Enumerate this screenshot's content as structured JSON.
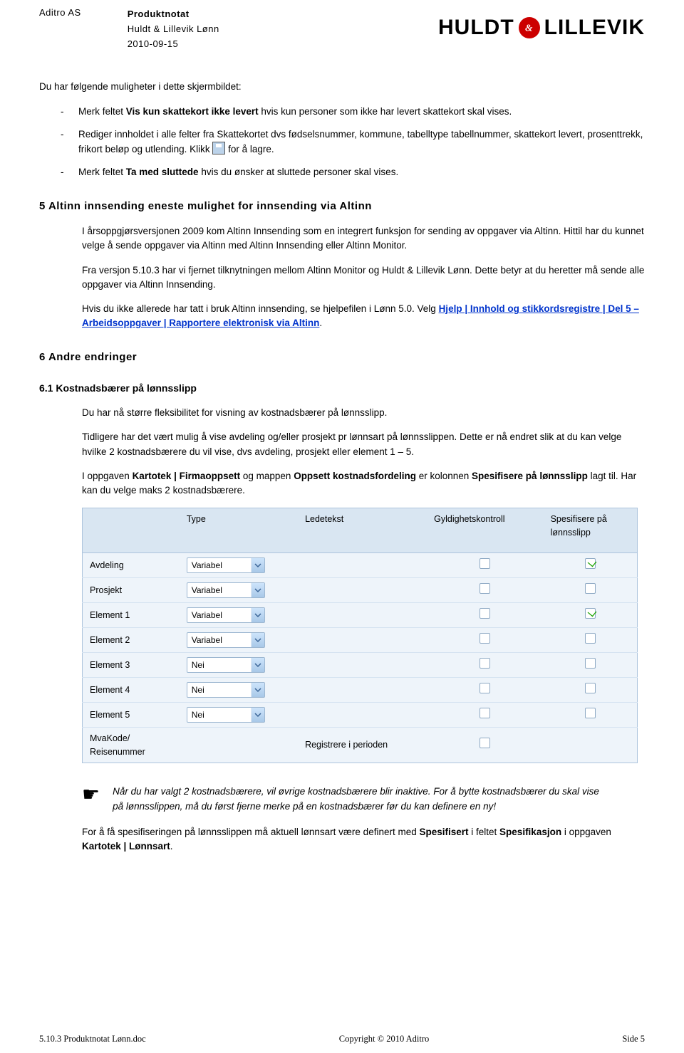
{
  "header": {
    "company": "Aditro AS",
    "title": "Produktnotat",
    "product": "Huldt & Lillevik Lønn",
    "date": "2010-09-15",
    "logo_text1": "HULDT",
    "logo_text2": "LILLEVIK"
  },
  "intro": "Du har følgende muligheter i dette skjermbildet:",
  "bullets": {
    "b1_a": "Merk feltet ",
    "b1_bold": "Vis kun skattekort ikke levert",
    "b1_b": " hvis kun personer som ikke har levert skattekort skal vises.",
    "b2_a": "Rediger innholdet i alle felter fra Skattekortet dvs fødselsnummer, kommune, tabelltype tabellnummer, skattekort levert, prosenttrekk, frikort beløp og utlending. Klikk ",
    "b2_b": " for å lagre.",
    "b3_a": "Merk feltet ",
    "b3_bold": "Ta med sluttede",
    "b3_b": " hvis du ønsker at sluttede personer skal vises."
  },
  "sec5_title": "5 Altinn innsending eneste mulighet for innsending via Altinn",
  "sec5": {
    "p1": "I årsoppgjørsversjonen 2009 kom Altinn Innsending som en integrert funksjon for sending av oppgaver via Altinn. Hittil har du kunnet velge å sende oppgaver via Altinn med Altinn Innsending eller Altinn Monitor.",
    "p2": "Fra versjon 5.10.3 har vi fjernet tilknytningen mellom Altinn Monitor og Huldt & Lillevik Lønn. Dette betyr at du heretter må sende alle oppgaver via Altinn Innsending.",
    "p3a": "Hvis du ikke allerede har tatt i bruk Altinn innsending, se hjelpefilen i Lønn 5.0.  Velg ",
    "p3link": "Hjelp | Innhold og stikkordsregistre | Del 5 – Arbeidsoppgaver | Rapportere elektronisk via Altinn",
    "p3b": "."
  },
  "sec6_title": "6 Andre endringer",
  "sec61_title": "6.1 Kostnadsbærer på lønnsslipp",
  "sec61": {
    "p1": "Du har nå større fleksibilitet for visning av kostnadsbærer på lønnsslipp.",
    "p2": "Tidligere har det vært mulig å vise avdeling og/eller prosjekt pr lønnsart på lønnsslippen. Dette er nå endret slik at du kan velge hvilke 2 kostnadsbærere du vil vise, dvs avdeling, prosjekt eller element 1 – 5.",
    "p3a": "I oppgaven ",
    "p3bold1": "Kartotek | Firmaoppsett",
    "p3mid": " og mappen ",
    "p3bold2": "Oppsett kostnadsfordeling",
    "p3b": " er kolonnen ",
    "p3bold3": "Spesifisere på lønnsslipp",
    "p3c": " lagt til. Har kan du velge maks 2 kostnadsbærere."
  },
  "table": {
    "headers": [
      "",
      "Type",
      "Ledetekst",
      "Gyldighetskontroll",
      "Spesifisere på lønnsslipp"
    ],
    "rows": [
      {
        "label": "Avdeling",
        "type": "Variabel",
        "ledetekst": "",
        "gk": false,
        "sp": true
      },
      {
        "label": "Prosjekt",
        "type": "Variabel",
        "ledetekst": "",
        "gk": false,
        "sp": false
      },
      {
        "label": "Element 1",
        "type": "Variabel",
        "ledetekst": "",
        "gk": false,
        "sp": true
      },
      {
        "label": "Element 2",
        "type": "Variabel",
        "ledetekst": "",
        "gk": false,
        "sp": false
      },
      {
        "label": "Element 3",
        "type": "Nei",
        "ledetekst": "",
        "gk": false,
        "sp": false
      },
      {
        "label": "Element 4",
        "type": "Nei",
        "ledetekst": "",
        "gk": false,
        "sp": false
      },
      {
        "label": "Element 5",
        "type": "Nei",
        "ledetekst": "",
        "gk": false,
        "sp": false
      },
      {
        "label": "MvaKode/ Reisenummer",
        "type": "",
        "ledetekst": "Registrere i perioden",
        "gk": false,
        "sp": null
      }
    ]
  },
  "hand_note": "Når du har valgt 2 kostnadsbærere, vil øvrige kostnadsbærere blir inaktive. For å bytte kostnadsbærer du skal vise på lønnsslippen, må du først fjerne merke på en kostnadsbærer før du kan definere en ny!",
  "final": {
    "a": "For å få spesifiseringen på lønnsslippen må aktuell lønnsart være definert med ",
    "bold1": "Spesifisert",
    "b": " i feltet ",
    "bold2": "Spesifikasjon",
    "c": " i oppgaven ",
    "bold3": "Kartotek | Lønnsart",
    "d": "."
  },
  "footer": {
    "left": "5.10.3 Produktnotat Lønn.doc",
    "center": "Copyright © 2010 Aditro",
    "right": "Side 5"
  }
}
